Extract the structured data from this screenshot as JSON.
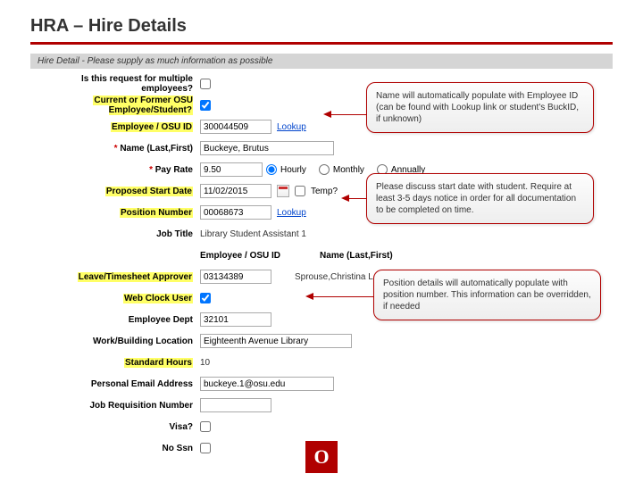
{
  "title": "HRA – Hire Details",
  "section_bar": "Hire Detail - Please supply as much information as possible",
  "labels": {
    "multi": "Is this request for multiple employees?",
    "former": "Current or Former OSU Employee/Student?",
    "emp_id": "Employee / OSU ID",
    "name": "Name (Last,First)",
    "pay_rate": "Pay Rate",
    "start_date": "Proposed Start Date",
    "temp": "Temp?",
    "position": "Position Number",
    "job_title": "Job Title",
    "approver_id": "Employee / OSU ID",
    "approver_name": "Name (Last,First)",
    "leave_approver": "Leave/Timesheet Approver",
    "web_clock": "Web Clock User",
    "dept": "Employee Dept",
    "location": "Work/Building Location",
    "std_hours": "Standard Hours",
    "email": "Personal Email Address",
    "req_num": "Job Requisition Number",
    "visa": "Visa?",
    "no_ssn": "No Ssn"
  },
  "values": {
    "emp_id": "300044509",
    "name": "Buckeye, Brutus",
    "pay_rate": "9.50",
    "start_date": "11/02/2015",
    "position": "00068673",
    "job_title": "Library Student Assistant 1",
    "approver_id": "03134389",
    "approver_name": "Sprouse,Christina Louise",
    "dept": "32101",
    "location": "Eighteenth Avenue Library",
    "std_hours": "10",
    "email": "buckeye.1@osu.edu",
    "req_num": ""
  },
  "period": {
    "hourly": "Hourly",
    "monthly": "Monthly",
    "annually": "Annually"
  },
  "lookup": "Lookup",
  "callouts": {
    "c1": "Name will automatically populate with Employee ID (can be found with Lookup link or student's BuckID, if unknown)",
    "c2": "Please discuss start date with student. Require at least 3-5 days notice in order for all documentation to be completed on time.",
    "c3": "Position details will automatically populate with position number. This information can be overridden, if needed"
  },
  "logo_letter": "O"
}
